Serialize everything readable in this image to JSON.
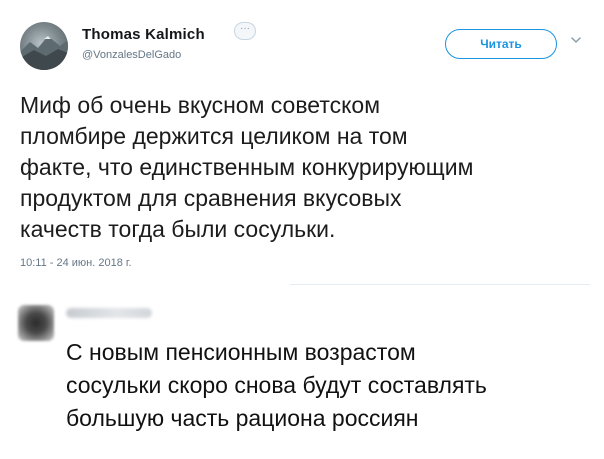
{
  "tweet": {
    "author_name": "Thomas Kalmich",
    "more_glyph": "···",
    "handle": "@VonzalesDelGado",
    "follow_label": "Читать",
    "text_lines": [
      "Миф об очень вкусном советском",
      "пломбире держится целиком на том",
      "факте, что единственным конкурирующим",
      "продуктом для сравнения вкусовых",
      "качеств тогда были сосульки."
    ],
    "timestamp": "10:11 - 24 июн. 2018 г."
  },
  "comment": {
    "text_lines": [
      "С новым пенсионным возрастом",
      "сосульки скоро снова будут составлять",
      "большую часть рациона россиян"
    ]
  },
  "colors": {
    "accent": "#1b95e0",
    "secondary_text": "#657786",
    "primary_text": "#1c1c1c"
  },
  "icons": {
    "options": "chevron-down-icon",
    "more": "more-dots-icon"
  }
}
